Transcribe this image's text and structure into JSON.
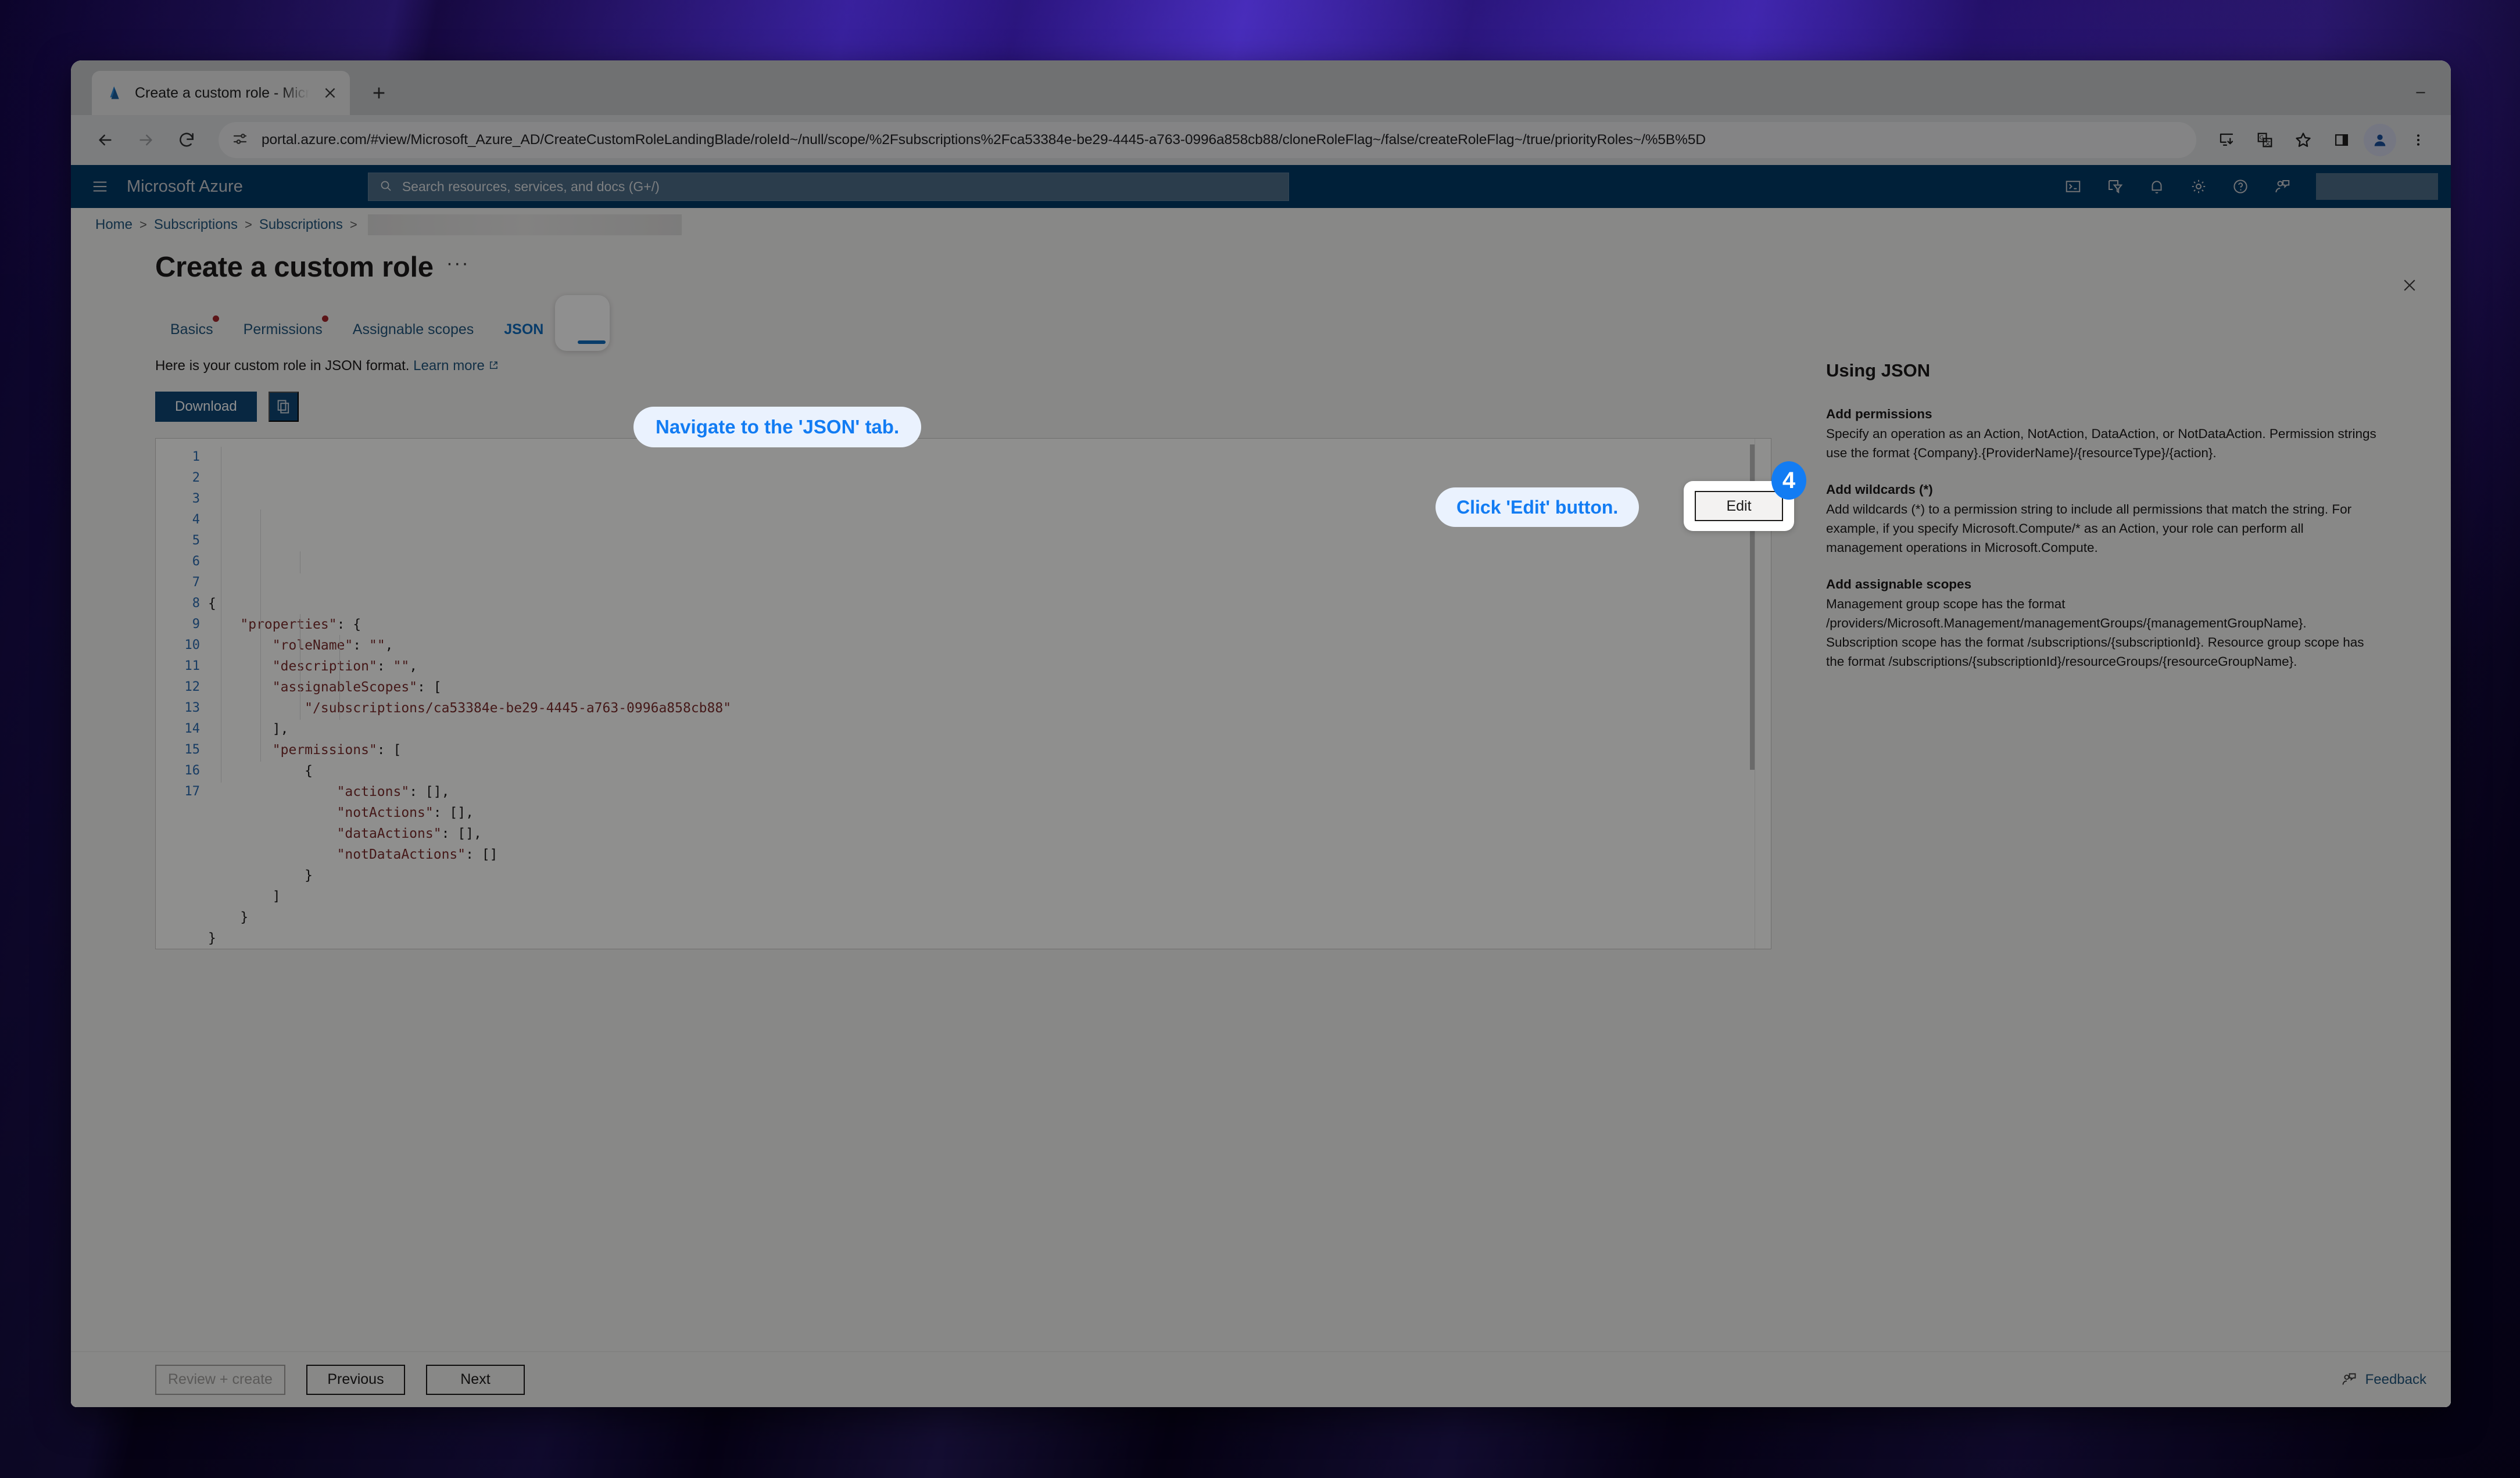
{
  "browser": {
    "tab": {
      "title": "Create a custom role - Micros",
      "favicon_icon": "azure-logo-icon",
      "close_icon": "close-icon"
    },
    "new_tab_label": "+",
    "nav": {
      "back_icon": "back-arrow-icon",
      "forward_icon": "forward-arrow-icon",
      "reload_icon": "reload-icon"
    },
    "omnibox": {
      "site_icon": "site-settings-icon",
      "url": "portal.azure.com/#view/Microsoft_Azure_AD/CreateCustomRoleLandingBlade/roleId~/null/scope/%2Fsubscriptions%2Fca53384e-be29-4445-a763-0996a858cb88/cloneRoleFlag~/false/createRoleFlag~/true/priorityRoles~/%5B%5D"
    },
    "toolbar_icons": [
      "install-app-icon",
      "translate-icon",
      "bookmark-star-icon",
      "side-panel-icon",
      "profile-avatar-icon",
      "chrome-menu-icon"
    ],
    "window_controls": [
      "minimize-icon",
      "maximize-icon",
      "close-window-icon"
    ]
  },
  "azure_header": {
    "menu_icon": "hamburger-menu-icon",
    "brand": "Microsoft Azure",
    "search_placeholder": "Search resources, services, and docs (G+/)",
    "search_icon": "search-icon",
    "icons": [
      "cloud-shell-icon",
      "directories-filter-icon",
      "notifications-bell-icon",
      "settings-gear-icon",
      "help-question-icon",
      "feedback-person-icon"
    ]
  },
  "breadcrumb": {
    "items": [
      "Home",
      "Subscriptions",
      "Subscriptions"
    ],
    "separator": ">"
  },
  "blade": {
    "title": "Create a custom role",
    "more_menu": "···",
    "close_icon": "close-icon"
  },
  "pivot": {
    "items": [
      {
        "label": "Basics",
        "required": true,
        "selected": false
      },
      {
        "label": "Permissions",
        "required": true,
        "selected": false
      },
      {
        "label": "Assignable scopes",
        "required": false,
        "selected": false
      },
      {
        "label": "JSON",
        "required": false,
        "selected": true
      }
    ]
  },
  "annotations": {
    "callout_json": "Navigate to the 'JSON' tab.",
    "callout_edit": "Click 'Edit' button.",
    "step_number": "4",
    "accent_color": "#127cf3",
    "callout_bg": "#eaf2fe"
  },
  "content": {
    "help_text": "Here is your custom role in JSON format.",
    "learn_more": "Learn more",
    "learn_more_icon": "external-link-icon",
    "download_label": "Download",
    "copy_icon": "copy-icon",
    "edit_label": "Edit"
  },
  "editor": {
    "line_numbers": [
      "1",
      "2",
      "3",
      "4",
      "5",
      "6",
      "7",
      "8",
      "9",
      "10",
      "11",
      "12",
      "13",
      "14",
      "15",
      "16",
      "17"
    ],
    "lines": [
      "{",
      "    \"properties\": {",
      "        \"roleName\": \"\",",
      "        \"description\": \"\",",
      "        \"assignableScopes\": [",
      "            \"/subscriptions/ca53384e-be29-4445-a763-0996a858cb88\"",
      "        ],",
      "        \"permissions\": [",
      "            {",
      "                \"actions\": [],",
      "                \"notActions\": [],",
      "                \"dataActions\": [],",
      "                \"notDataActions\": []",
      "            }",
      "        ]",
      "    }",
      "}"
    ]
  },
  "info_pane": {
    "title": "Using JSON",
    "sections": [
      {
        "heading": "Add permissions",
        "body": "Specify an operation as an Action, NotAction, DataAction, or NotDataAction. Permission strings use the format {Company}.{ProviderName}/{resourceType}/{action}."
      },
      {
        "heading": "Add wildcards (*)",
        "body": "Add wildcards (*) to a permission string to include all permissions that match the string. For example, if you specify Microsoft.Compute/* as an Action, your role can perform all management operations in Microsoft.Compute."
      },
      {
        "heading": "Add assignable scopes",
        "body": "Management group scope has the format /providers/Microsoft.Management/managementGroups/{managementGroupName}. Subscription scope has the format /subscriptions/{subscriptionId}. Resource group scope has the format /subscriptions/{subscriptionId}/resourceGroups/{resourceGroupName}."
      }
    ]
  },
  "footer": {
    "review_create": "Review + create",
    "previous": "Previous",
    "next": "Next",
    "feedback": "Feedback",
    "feedback_icon": "feedback-person-icon"
  }
}
